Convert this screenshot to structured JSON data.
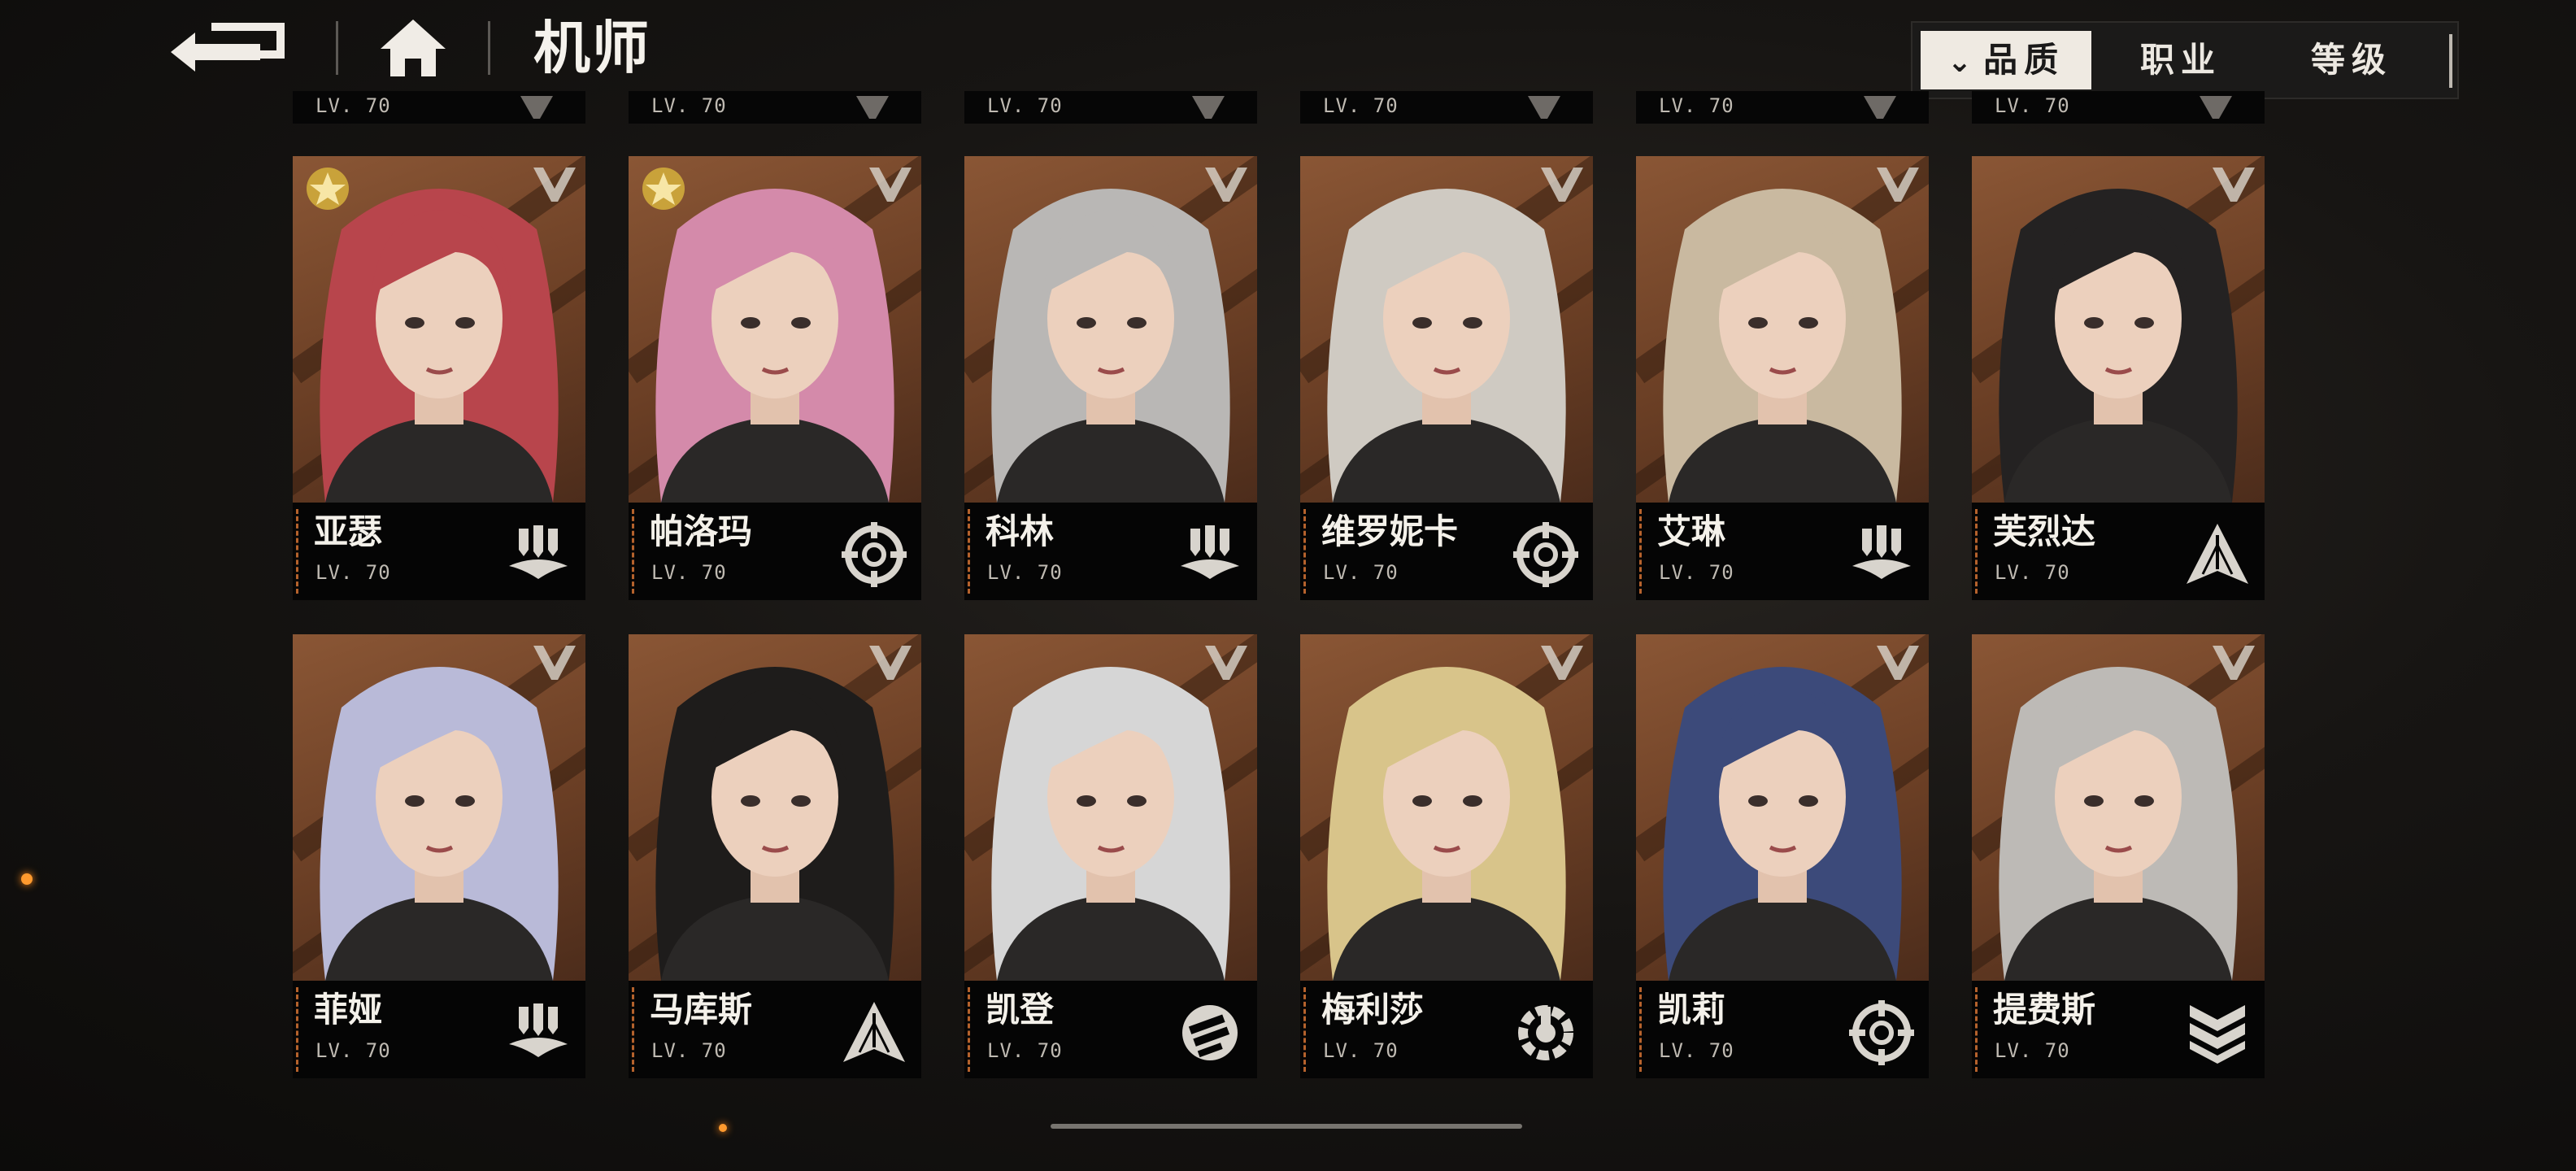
{
  "header": {
    "title": "机师"
  },
  "sort": {
    "tabs": [
      {
        "label": "品质",
        "active": true
      },
      {
        "label": "职业",
        "active": false
      },
      {
        "label": "等级",
        "active": false
      }
    ]
  },
  "partial_row": [
    {
      "level": "LV. 70"
    },
    {
      "level": "LV. 70"
    },
    {
      "level": "LV. 70"
    },
    {
      "level": "LV. 70"
    },
    {
      "level": "LV. 70"
    },
    {
      "level": "LV. 70"
    }
  ],
  "cards": [
    {
      "name": "亚瑟",
      "level": "LV. 70",
      "class_icon": "bomb-wing-icon",
      "star": true,
      "hair": "#b8454c"
    },
    {
      "name": "帕洛玛",
      "level": "LV. 70",
      "class_icon": "target-icon",
      "star": true,
      "hair": "#d48aaa"
    },
    {
      "name": "科林",
      "level": "LV. 70",
      "class_icon": "bomb-wing-icon",
      "star": false,
      "hair": "#b9b7b5"
    },
    {
      "name": "维罗妮卡",
      "level": "LV. 70",
      "class_icon": "target-icon",
      "star": false,
      "hair": "#cfcac2"
    },
    {
      "name": "艾琳",
      "level": "LV. 70",
      "class_icon": "bomb-wing-icon",
      "star": false,
      "hair": "#c9b9a0"
    },
    {
      "name": "芙烈达",
      "level": "LV. 70",
      "class_icon": "arrowhead-icon",
      "star": false,
      "hair": "#242222"
    },
    {
      "name": "菲娅",
      "level": "LV. 70",
      "class_icon": "bomb-wing-icon",
      "star": false,
      "hair": "#b9bad8"
    },
    {
      "name": "马库斯",
      "level": "LV. 70",
      "class_icon": "arrowhead-icon",
      "star": false,
      "hair": "#1e1c1b"
    },
    {
      "name": "凯登",
      "level": "LV. 70",
      "class_icon": "fist-icon",
      "star": false,
      "hair": "#d6d6d6"
    },
    {
      "name": "梅利莎",
      "level": "LV. 70",
      "class_icon": "wrench-gear-icon",
      "star": false,
      "hair": "#d8c48a"
    },
    {
      "name": "凯莉",
      "level": "LV. 70",
      "class_icon": "target-icon",
      "star": false,
      "hair": "#3c4a7a"
    },
    {
      "name": "提费斯",
      "level": "LV. 70",
      "class_icon": "shield-chevron-icon",
      "star": false,
      "hair": "#bdbab6"
    }
  ]
}
